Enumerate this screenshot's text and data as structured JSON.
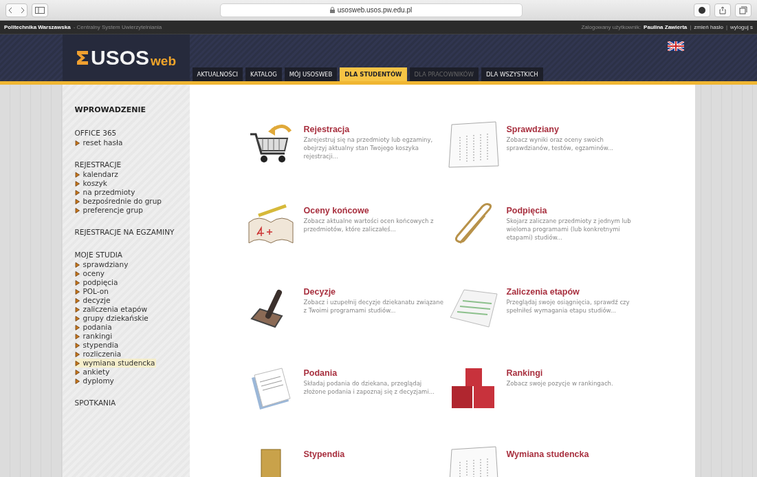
{
  "browser": {
    "url": "usosweb.usos.pw.edu.pl"
  },
  "top_bar": {
    "institution": "Politechnika Warszawska",
    "system": "- Centralny System Uwierzytelniania",
    "user_label": "Zalogowany użytkownik:",
    "user_name": "Paulina Zawierta",
    "separator": "|",
    "links": [
      "zmień hasło",
      "wyloguj s"
    ]
  },
  "logo": {
    "main": "USOS",
    "sub": "web"
  },
  "tabs": [
    {
      "label": "AKTUALNOŚCI",
      "selected": false,
      "disabled": false
    },
    {
      "label": "KATALOG",
      "selected": false,
      "disabled": false
    },
    {
      "label": "MÓJ USOSWEB",
      "selected": false,
      "disabled": false
    },
    {
      "label": "DLA STUDENTÓW",
      "selected": true,
      "disabled": false
    },
    {
      "label": "DLA PRACOWNIKÓW",
      "selected": false,
      "disabled": true
    },
    {
      "label": "DLA WSZYSTKICH",
      "selected": false,
      "disabled": false
    }
  ],
  "sidebar": {
    "title": "WPROWADZENIE",
    "sections": [
      {
        "heading": "OFFICE 365",
        "items": [
          {
            "label": "reset hasła",
            "selected": false
          }
        ]
      },
      {
        "heading": "REJESTRACJE",
        "items": [
          {
            "label": "kalendarz",
            "selected": false
          },
          {
            "label": "koszyk",
            "selected": false
          },
          {
            "label": "na przedmioty",
            "selected": false
          },
          {
            "label": "bezpośrednie do grup",
            "selected": false
          },
          {
            "label": "preferencje grup",
            "selected": false
          }
        ]
      },
      {
        "heading": "REJESTRACJE NA EGZAMINY"
      },
      {
        "heading": "MOJE STUDIA",
        "items": [
          {
            "label": "sprawdziany",
            "selected": false
          },
          {
            "label": "oceny",
            "selected": false
          },
          {
            "label": "podpięcia",
            "selected": false
          },
          {
            "label": "POL-on",
            "selected": false
          },
          {
            "label": "decyzje",
            "selected": false
          },
          {
            "label": "zaliczenia etapów",
            "selected": false
          },
          {
            "label": "grupy dziekańskie",
            "selected": false
          },
          {
            "label": "podania",
            "selected": false
          },
          {
            "label": "rankingi",
            "selected": false
          },
          {
            "label": "stypendia",
            "selected": false
          },
          {
            "label": "rozliczenia",
            "selected": false
          },
          {
            "label": "wymiana studencka",
            "selected": true
          },
          {
            "label": "ankiety",
            "selected": false
          },
          {
            "label": "dyplomy",
            "selected": false
          }
        ]
      },
      {
        "heading": "SPOTKANIA"
      }
    ]
  },
  "tiles": [
    {
      "kind": "cart",
      "title": "Rejestracja",
      "description": "Zarejestruj się na przedmioty lub egzaminy, obejrzyj aktualny stan Twojego koszyka rejestracji..."
    },
    {
      "kind": "sheet",
      "title": "Sprawdziany",
      "description": "Zobacz wyniki oraz oceny swoich sprawdzianów, testów, egzaminów..."
    },
    {
      "kind": "grade",
      "title": "Oceny końcowe",
      "description": "Zobacz aktualne wartości ocen końcowych z przedmiotów, które zaliczałeś..."
    },
    {
      "kind": "clip",
      "title": "Podpięcia",
      "description": "Skojarz zaliczane przedmioty z jednym lub wieloma programami (lub konkretnymi etapami) studiów..."
    },
    {
      "kind": "stamp",
      "title": "Decyzje",
      "description": "Zobacz i uzupełnij decyzje dziekanatu związane z Twoimi programami studiów..."
    },
    {
      "kind": "report",
      "title": "Zaliczenia etapów",
      "description": "Przeglądaj swoje osiągnięcia, sprawdź czy spełniłeś wymagania etapu studiów..."
    },
    {
      "kind": "letter",
      "title": "Podania",
      "description": "Składaj podania do dziekana, przeglądaj złożone podania i zapoznaj się z decyzjami..."
    },
    {
      "kind": "podium",
      "title": "Rankingi",
      "description": "Zobacz swoje pozycje w rankingach."
    },
    {
      "kind": "coins",
      "title": "Stypendia"
    },
    {
      "kind": "sheet",
      "title": "Wymiana studencka"
    }
  ]
}
